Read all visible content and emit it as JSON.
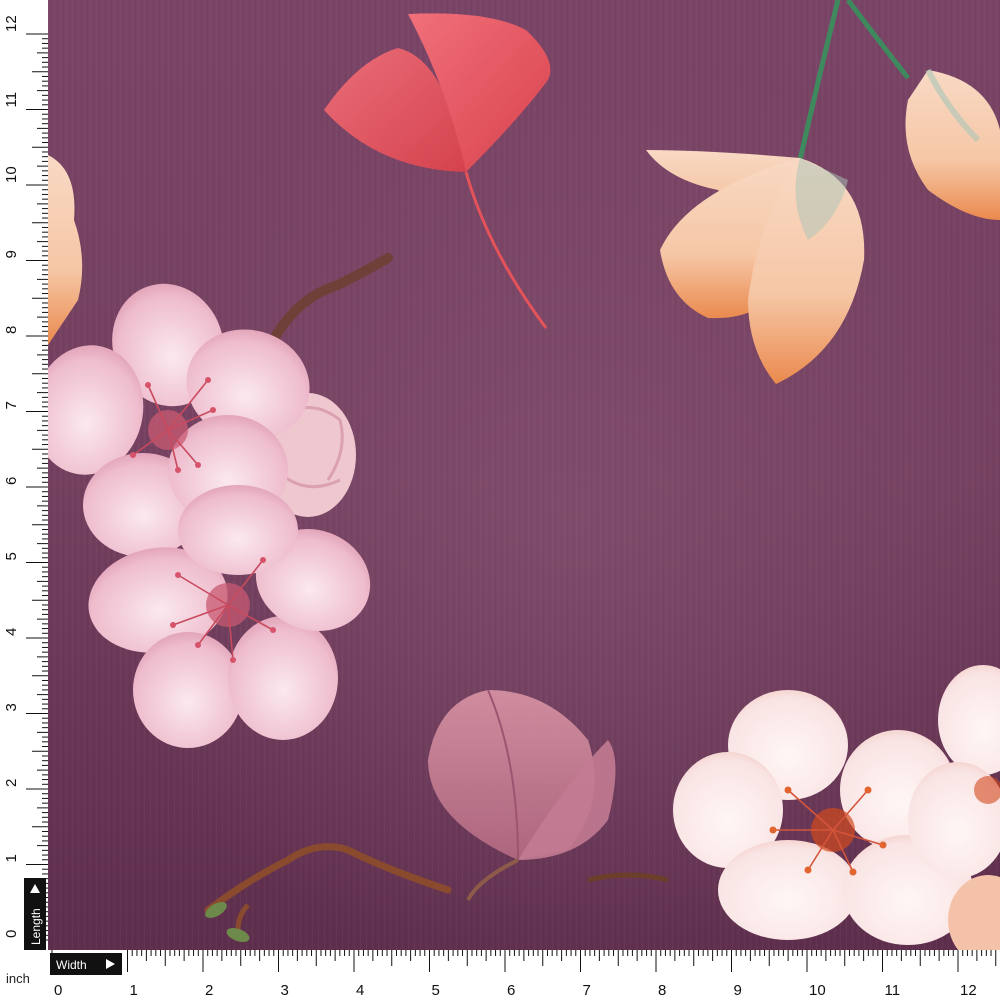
{
  "ruler": {
    "unit_label": "inch",
    "length_label": "Length",
    "width_label": "Width",
    "length_marks": [
      "0",
      "1",
      "2",
      "3",
      "4",
      "5",
      "6",
      "7",
      "8",
      "9",
      "10",
      "11",
      "12"
    ],
    "width_marks": [
      "0",
      "1",
      "2",
      "3",
      "4",
      "5",
      "6",
      "7",
      "8",
      "9",
      "10",
      "11",
      "12"
    ]
  },
  "colors": {
    "fabric_base": "#6e3a5c",
    "fabric_dark": "#5a2c4b",
    "fabric_light": "#8a5676",
    "petal_light": "#f6e2e8",
    "petal_pink": "#e9b8c8",
    "petal_peach": "#f7c9a8",
    "petal_orange": "#e87a3c",
    "ginkgo_red": "#e4525a",
    "stem_green": "#3e8a5e",
    "branch_brown": "#6b3f2a",
    "ruler_ink": "#111111"
  },
  "icons": {
    "length_arrow": "triangle-up-icon",
    "width_arrow": "triangle-right-icon"
  }
}
